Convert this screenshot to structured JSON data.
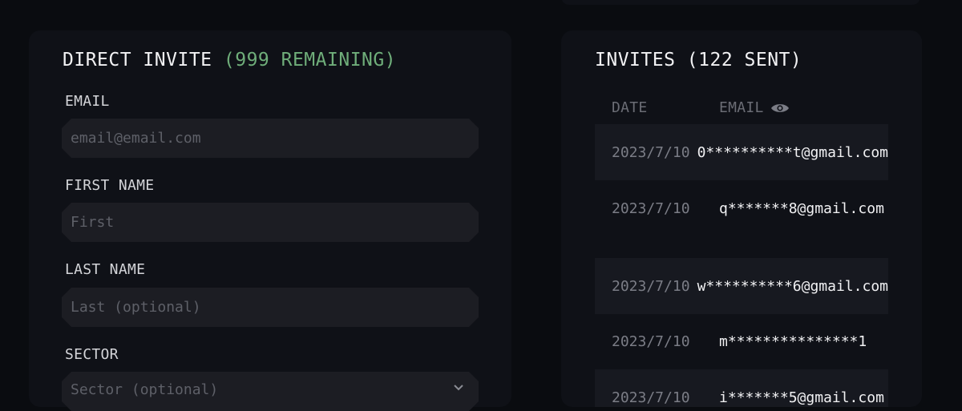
{
  "invite_form": {
    "title": "DIRECT INVITE",
    "remaining": "(999 REMAINING)",
    "email": {
      "label": "EMAIL",
      "placeholder": "email@email.com"
    },
    "first_name": {
      "label": "FIRST NAME",
      "placeholder": "First"
    },
    "last_name": {
      "label": "LAST NAME",
      "placeholder": "Last (optional)"
    },
    "sector": {
      "label": "SECTOR",
      "placeholder": "Sector (optional)"
    }
  },
  "invites": {
    "title": "INVITES (122 SENT)",
    "columns": {
      "date": "DATE",
      "email": "EMAIL"
    },
    "rows": [
      {
        "date": "2023/7/10",
        "email": "0**********t@gmail.com"
      },
      {
        "date": "2023/7/10",
        "email": "q*******8@gmail.com"
      },
      {
        "date": "2023/7/10",
        "email": "w**********6@gmail.com"
      },
      {
        "date": "2023/7/10",
        "email": "m***************1"
      },
      {
        "date": "2023/7/10",
        "email": "i*******5@gmail.com"
      }
    ]
  },
  "colors": {
    "accent": "#6fae7a",
    "card": "#0f1117",
    "field": "#1c1d23",
    "background": "#0a0c10"
  },
  "icons": {
    "reveal": "eye-icon",
    "dropdown": "chevron-down-icon"
  }
}
